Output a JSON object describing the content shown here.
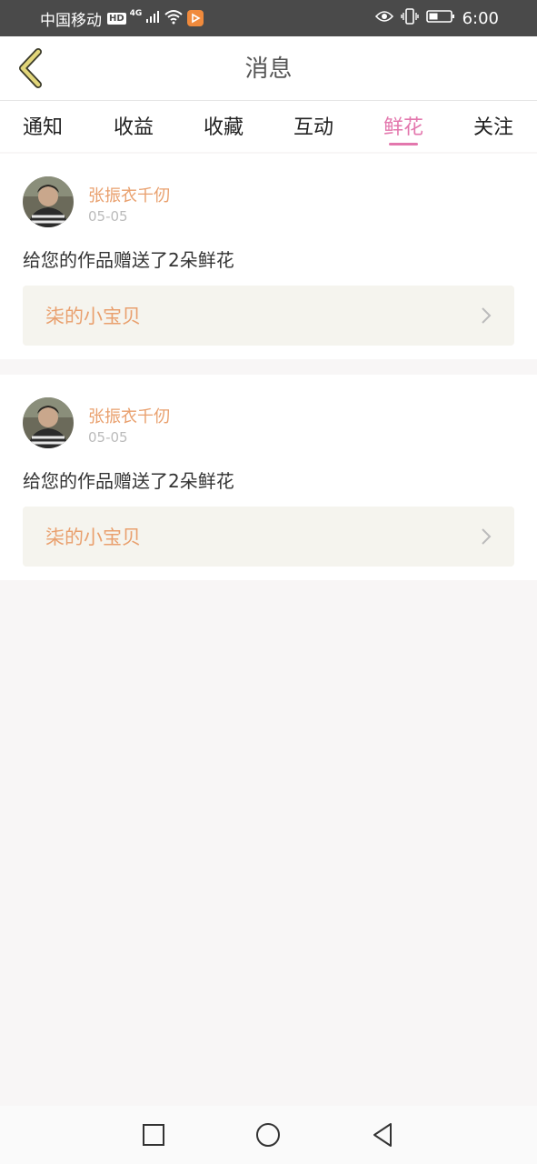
{
  "status_bar": {
    "carrier": "中国移动",
    "hd_badge": "HD",
    "network": "4G",
    "time": "6:00",
    "icons": [
      "signal-icon",
      "wifi-icon",
      "app-notification-icon",
      "eye-comfort-icon",
      "vibrate-icon",
      "battery-icon"
    ]
  },
  "header": {
    "title": "消息",
    "back_icon": "chevron-left-icon"
  },
  "tabs": [
    {
      "label": "通知",
      "active": false
    },
    {
      "label": "收益",
      "active": false
    },
    {
      "label": "收藏",
      "active": false
    },
    {
      "label": "互动",
      "active": false
    },
    {
      "label": "鲜花",
      "active": true
    },
    {
      "label": "关注",
      "active": false
    }
  ],
  "messages": [
    {
      "user_name": "张振衣千仞",
      "date": "05-05",
      "text": "给您的作品赠送了2朵鲜花",
      "work_title": "柒的小宝贝"
    },
    {
      "user_name": "张振衣千仞",
      "date": "05-05",
      "text": "给您的作品赠送了2朵鲜花",
      "work_title": "柒的小宝贝"
    }
  ],
  "nav_bar": {
    "icons": [
      "recent-apps-icon",
      "home-icon",
      "back-triangle-icon"
    ]
  },
  "colors": {
    "accent": "#e377ad",
    "name": "#e9a06e",
    "status_bar": "#4a4a4a",
    "page_bg": "#f8f6f6",
    "back_icon": "#e2d67a"
  }
}
